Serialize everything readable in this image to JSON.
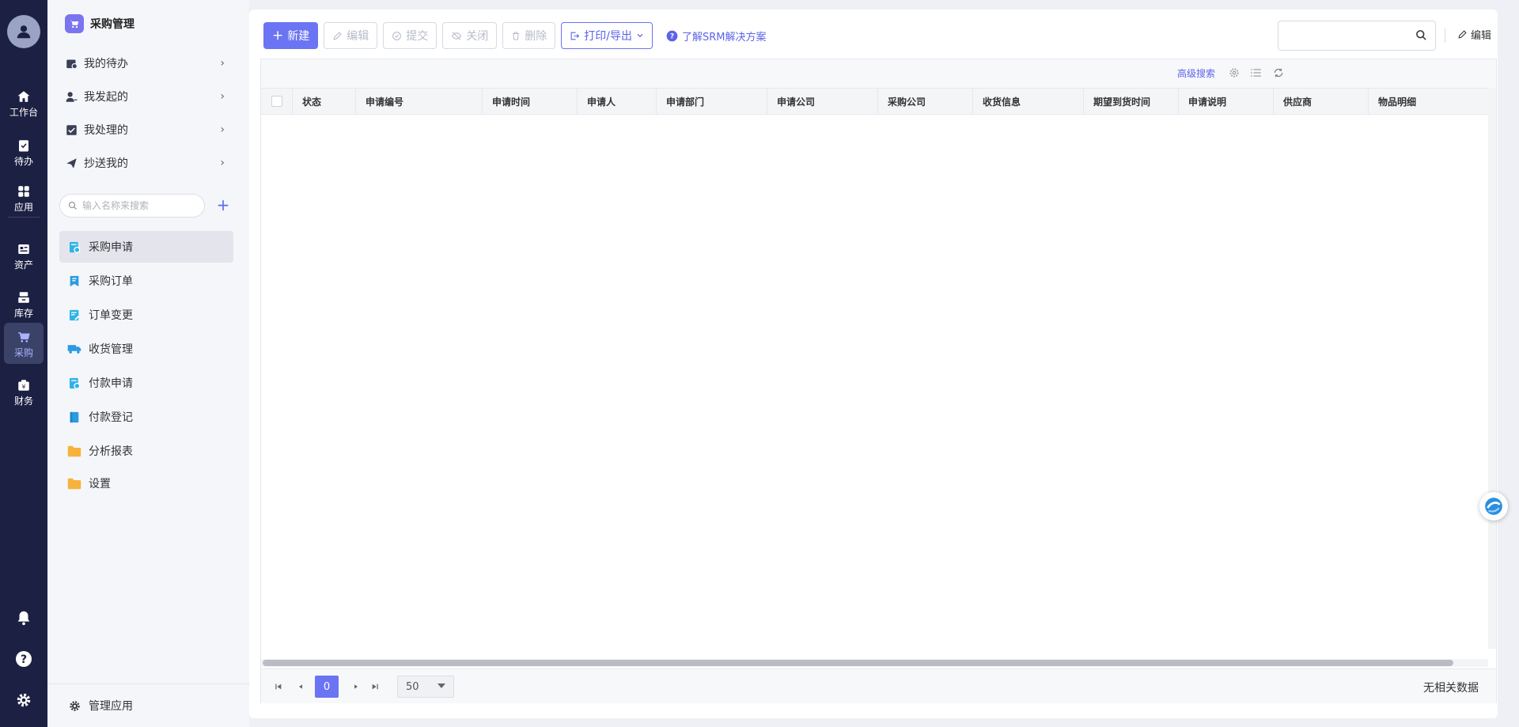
{
  "rail": {
    "items": [
      {
        "label": "工作台",
        "icon": "home-icon"
      },
      {
        "label": "待办",
        "icon": "clipboard-check-icon"
      },
      {
        "label": "应用",
        "icon": "apps-grid-icon"
      },
      {
        "label": "资产",
        "icon": "assets-icon"
      },
      {
        "label": "库存",
        "icon": "inventory-icon"
      },
      {
        "label": "采购",
        "icon": "cart-icon",
        "active": true
      },
      {
        "label": "财务",
        "icon": "finance-icon"
      }
    ],
    "bottom_icons": [
      "bell-icon",
      "help-icon",
      "gear-icon"
    ]
  },
  "sidebar": {
    "title": "采购管理",
    "nav": [
      {
        "label": "我的待办"
      },
      {
        "label": "我发起的"
      },
      {
        "label": "我处理的"
      },
      {
        "label": "抄送我的"
      }
    ],
    "search_placeholder": "输入名称来搜索",
    "apps": [
      {
        "label": "采购申请",
        "active": true
      },
      {
        "label": "采购订单"
      },
      {
        "label": "订单变更"
      },
      {
        "label": "收货管理"
      },
      {
        "label": "付款申请"
      },
      {
        "label": "付款登记"
      },
      {
        "label": "分析报表"
      },
      {
        "label": "设置"
      }
    ],
    "footer_label": "管理应用"
  },
  "toolbar": {
    "new_label": "新建",
    "edit_label": "编辑",
    "submit_label": "提交",
    "close_label": "关闭",
    "delete_label": "删除",
    "print_label": "打印/导出",
    "help_link": "了解SRM解决方案",
    "search_placeholder": "",
    "edit_link": "编辑"
  },
  "grid": {
    "advanced_search": "高级搜索",
    "columns": [
      "状态",
      "申请编号",
      "申请时间",
      "申请人",
      "申请部门",
      "申请公司",
      "采购公司",
      "收货信息",
      "期望到货时间",
      "申请说明",
      "供应商",
      "物品明细"
    ],
    "rows": []
  },
  "pager": {
    "current_page": "0",
    "page_size": "50",
    "status_text": "无相关数据"
  },
  "colors": {
    "accent": "#6b74f2",
    "rail_bg": "#1c2143",
    "sidebar_bg": "#f5f6fa"
  }
}
